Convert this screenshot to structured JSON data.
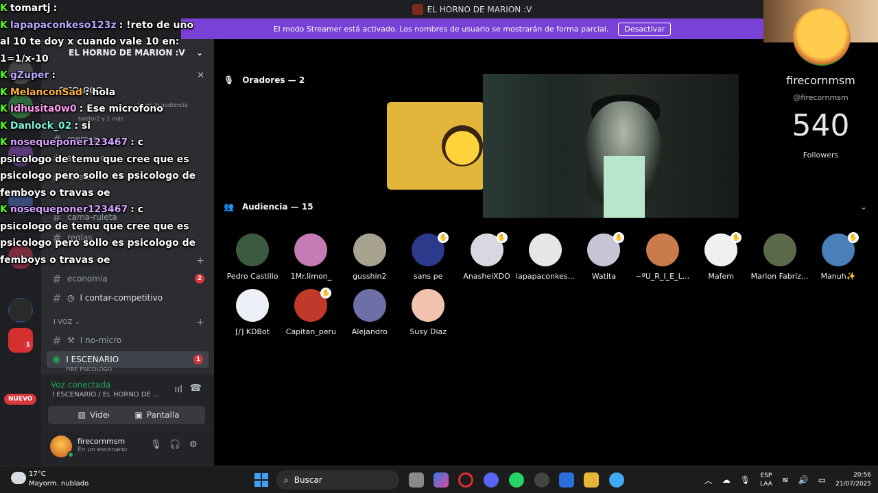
{
  "window": {
    "title": "EL HORNO DE MARION :V",
    "streamer_banner": "El modo Streamer está activado. Los nombres de usuario se mostrarán de forma parcial.",
    "streamer_button": "Desactivar"
  },
  "sidebar": {
    "server_name": "EL HORNO DE MARION :V",
    "event_label": "SICOLOGO",
    "event_sub": "15 en la audiencia",
    "event_sub2": "toletor2 y 1 más",
    "channels": [
      {
        "label": "memes"
      },
      {
        "label": "sugerencias"
      },
      {
        "label": "ruleta"
      },
      {
        "label": "cama-ruleta"
      },
      {
        "label": "reglas"
      },
      {
        "label": "economia"
      },
      {
        "label": "I contar-competitivo"
      }
    ],
    "economia_badge": "2",
    "voice_category": "I VOZ",
    "no_micro": "I no-micro",
    "stage_channel": "I ESCENARIO",
    "stage_badge": "1",
    "stage_sub": "FIRE PSICOLOGO",
    "new_badge": "NUEVO",
    "guild_badge": "1"
  },
  "voice": {
    "status": "Voz conectada",
    "location": "I ESCENARIO / EL HORNO DE ...",
    "video_button": "Video",
    "screen_button": "Pantalla"
  },
  "user": {
    "name": "firecornmsm",
    "status": "En un escenario"
  },
  "stage": {
    "speakers_header": "Oradores — 2",
    "audience_header": "Audiencia — 15",
    "audience": [
      {
        "name": "Pedro Castillo",
        "color": "#3c5a3f",
        "raised": false
      },
      {
        "name": "1Mr.limon_",
        "color": "#c47ab3",
        "raised": false
      },
      {
        "name": "gusshin2",
        "color": "#a8a38f",
        "raised": false
      },
      {
        "name": "sans pe",
        "color": "#2c3a8c",
        "raised": true
      },
      {
        "name": "AnasheiXDO",
        "color": "#d8d8e0",
        "raised": true
      },
      {
        "name": "lapapaconkes...",
        "color": "#e6e6e6",
        "raised": false
      },
      {
        "name": "Watita",
        "color": "#c9c3d6",
        "raised": true
      },
      {
        "name": "~ºU_R_I_E_L...",
        "color": "#c97b4c",
        "raised": false
      },
      {
        "name": "Mafem",
        "color": "#f0f0f0",
        "raised": true
      },
      {
        "name": "Marion Fabriz...",
        "color": "#5a6a4a",
        "raised": false
      },
      {
        "name": "Manuh✨",
        "color": "#4a7fb8",
        "raised": true
      },
      {
        "name": "[/] KDBot",
        "color": "#eef0f8",
        "raised": false
      },
      {
        "name": "Capitan_peru",
        "color": "#c0392b",
        "raised": true
      },
      {
        "name": "Alejandro",
        "color": "#6f6fa8",
        "raised": false
      },
      {
        "name": "Susy Diaz",
        "color": "#f2c4b0",
        "raised": false
      }
    ]
  },
  "followers": {
    "name": "firecornmsm",
    "handle": "@firecornmsm",
    "count": "540",
    "label": "Followers"
  },
  "chat": [
    {
      "user": "tomartj",
      "user_color": "#ffffff",
      "text": ""
    },
    {
      "user": "lapapaconkeso123z",
      "user_color": "#b8a9ff",
      "text": "!reto de uno"
    },
    {
      "user": "",
      "user_color": "#ffffff",
      "text": "al 10 te doy x cuando vale 10 en:"
    },
    {
      "user": "",
      "user_color": "#ffffff",
      "text": "1=1/x-10"
    },
    {
      "user": "gZuper",
      "user_color": "#b8a9ff",
      "text": ""
    },
    {
      "user": "",
      "user_color": "#ffffff",
      "text": ""
    },
    {
      "user": "MelanconSad",
      "user_color": "#ffb13b",
      "text": "hola"
    },
    {
      "user": "Idhusita0w0",
      "user_color": "#ff9df0",
      "text": "Ese microfono"
    },
    {
      "user": "Danlock_02",
      "user_color": "#7cf5d9",
      "text": "si"
    },
    {
      "user": "nosequeponer123467",
      "user_color": "#d6a3ff",
      "text": "c"
    },
    {
      "user": "",
      "user_color": "#ffffff",
      "text": "psicologo de temu que cree que es"
    },
    {
      "user": "",
      "user_color": "#ffffff",
      "text": "psicologo pero sollo es psicologo de"
    },
    {
      "user": "",
      "user_color": "#ffffff",
      "text": "femboys o travas oe"
    },
    {
      "user": "nosequeponer123467",
      "user_color": "#d6a3ff",
      "text": "c"
    },
    {
      "user": "",
      "user_color": "#ffffff",
      "text": "psicologo de temu que cree que es"
    },
    {
      "user": "",
      "user_color": "#ffffff",
      "text": "psicologo pero sollo es psicologo de"
    },
    {
      "user": "",
      "user_color": "#ffffff",
      "text": "femboys o travas oe"
    }
  ],
  "taskbar": {
    "temperature": "17°C",
    "weather": "Mayorm. nublado",
    "search": "Buscar",
    "lang1": "ESP",
    "lang2": "LAA",
    "time": "20:56",
    "date": "21/07/2025"
  }
}
